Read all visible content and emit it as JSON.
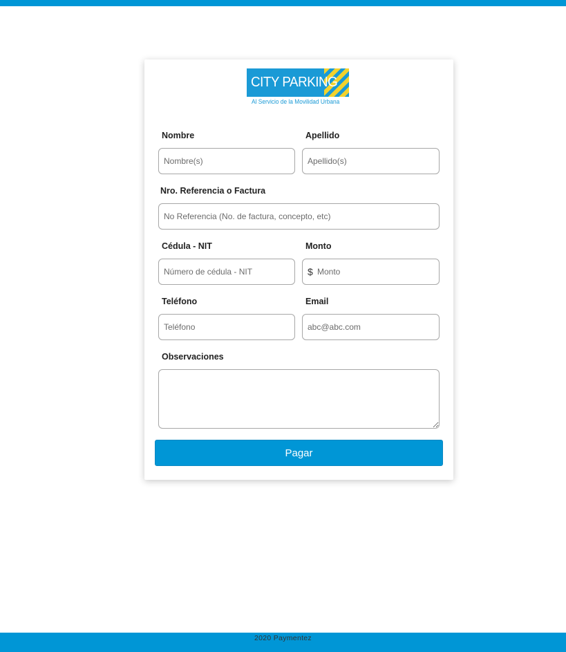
{
  "brand": {
    "logo_text": "CITY PARKING",
    "tagline": "Al Servicio de la Movilidad Urbana",
    "colors": {
      "primary": "#0096d6",
      "logo_blue": "#1a9ad6",
      "logo_yellow": "#f2d22e"
    }
  },
  "form": {
    "nombre": {
      "label": "Nombre",
      "placeholder": "Nombre(s)"
    },
    "apellido": {
      "label": "Apellido",
      "placeholder": "Apellido(s)"
    },
    "referencia": {
      "label": "Nro. Referencia o Factura",
      "placeholder": "No Referencia (No. de factura, concepto, etc)"
    },
    "cedula": {
      "label": "Cédula - NIT",
      "placeholder": "Número de cédula - NIT"
    },
    "monto": {
      "label": "Monto",
      "currency_symbol": "$",
      "placeholder": "Monto"
    },
    "telefono": {
      "label": "Teléfono",
      "placeholder": "Teléfono"
    },
    "email": {
      "label": "Email",
      "placeholder": "abc@abc.com"
    },
    "observaciones": {
      "label": "Observaciones",
      "value": ""
    },
    "submit_label": "Pagar"
  },
  "footer": {
    "text": "2020 Paymentez"
  }
}
